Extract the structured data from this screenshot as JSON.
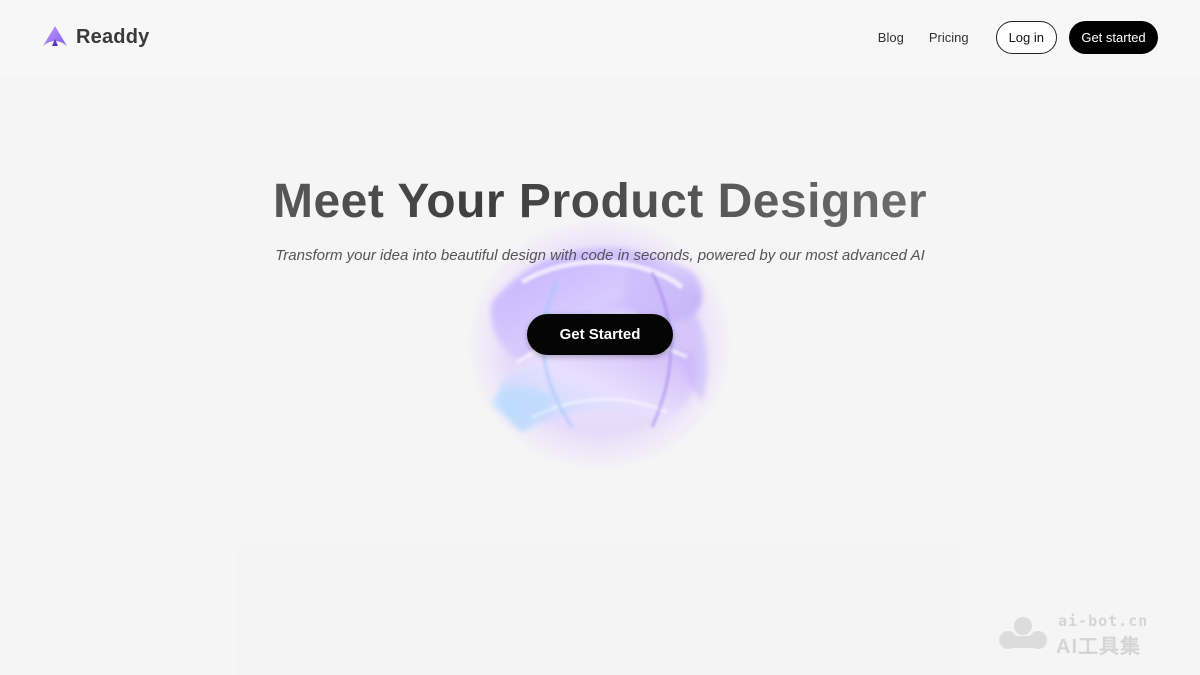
{
  "brand": {
    "name": "Readdy",
    "logo_icon": "readdy-logo-icon",
    "accent": "#a77cf4"
  },
  "nav": {
    "links": [
      "Blog",
      "Pricing"
    ],
    "login_label": "Log in",
    "cta_label": "Get started"
  },
  "hero": {
    "title": "Meet Your Product Designer",
    "subtitle": "Transform your idea into beautiful design with code in seconds, powered by our most advanced AI",
    "cta_label": "Get Started",
    "graphic": "glass-orb-illustration"
  },
  "watermark": {
    "icon": "watermark-logo-icon",
    "url": "ai-bot.cn",
    "name": "AI工具集"
  }
}
